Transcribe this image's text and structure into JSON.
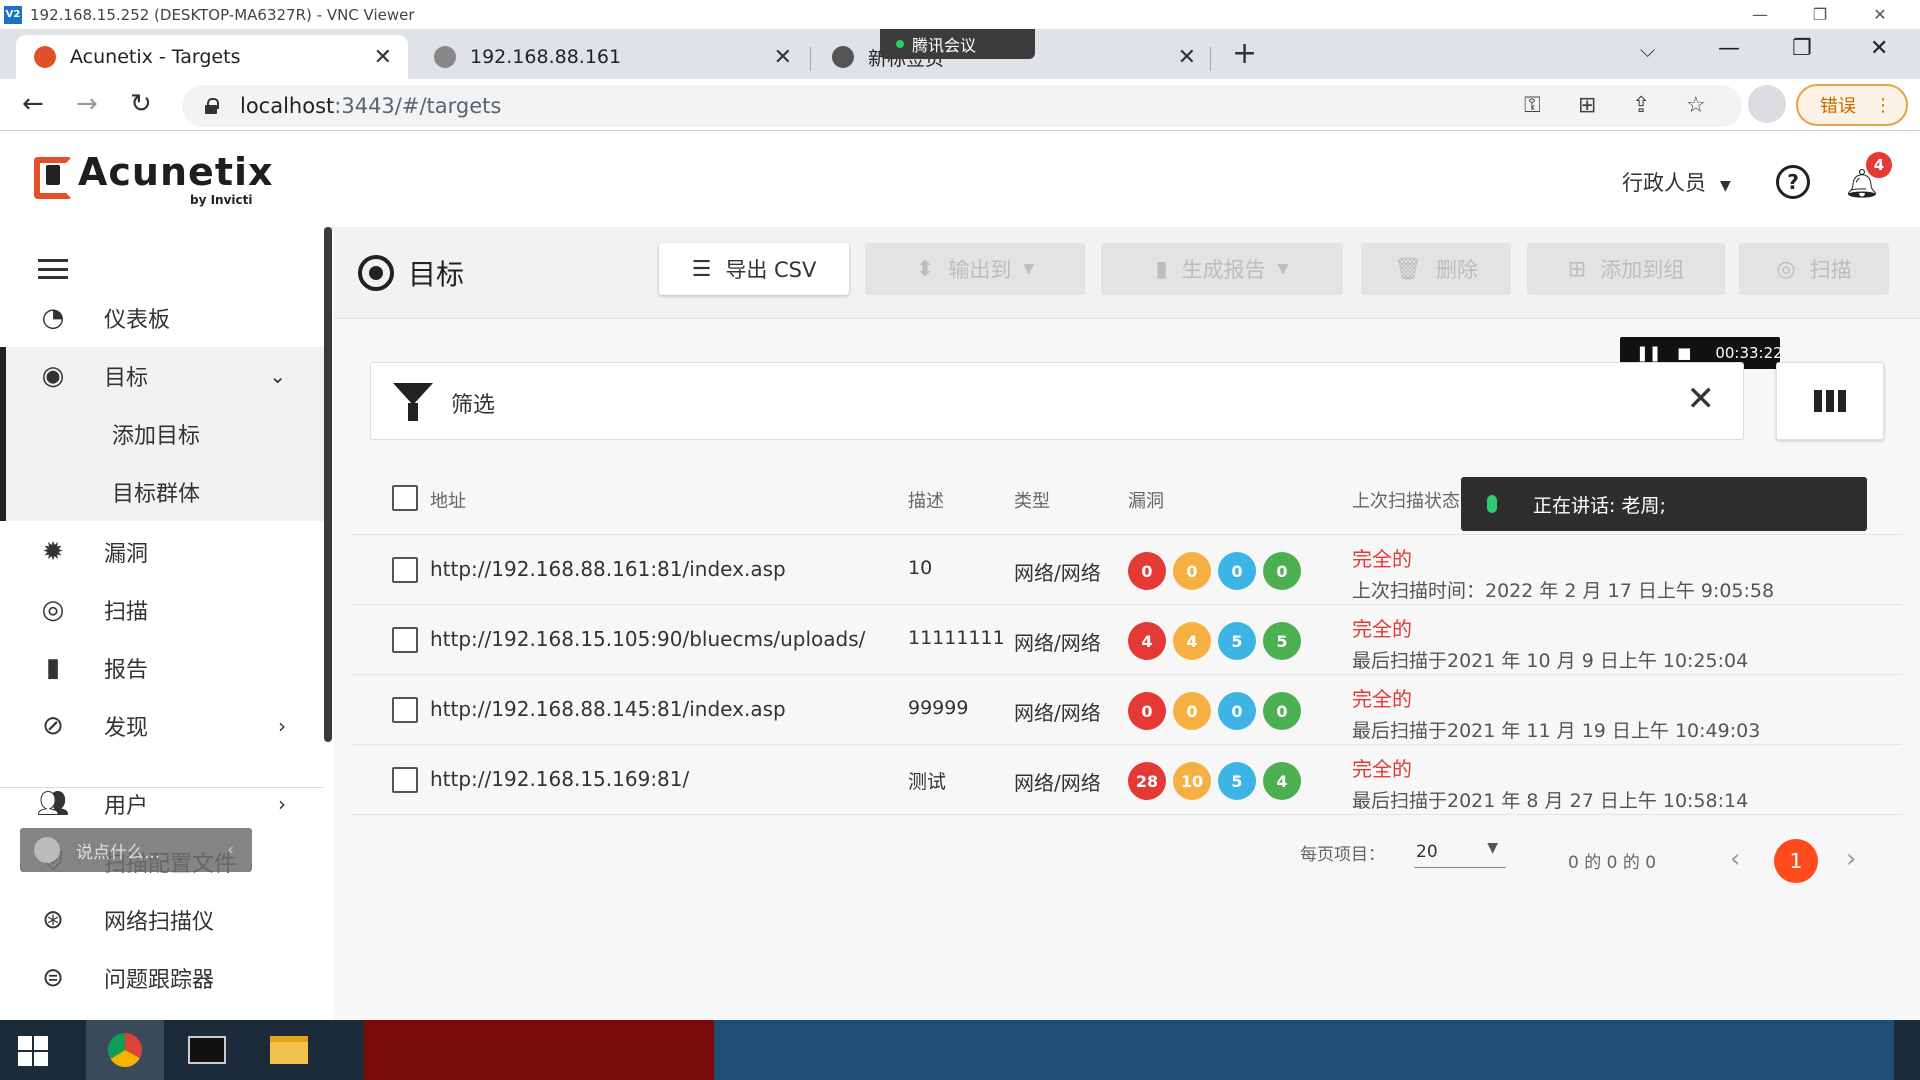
{
  "vnc": {
    "title": "192.168.15.252 (DESKTOP-MA6327R) - VNC Viewer",
    "logo": "V2"
  },
  "browser": {
    "tabs": [
      {
        "title": "Acunetix - Targets",
        "active": true
      },
      {
        "title": "192.168.88.161",
        "active": false
      },
      {
        "title": "新标签页",
        "active": false
      }
    ],
    "meeting_overlay": "腾讯会议",
    "url_host": "localhost",
    "url_rest": ":3443/#/targets",
    "error_button": "错误"
  },
  "app": {
    "logo_text": "Acunetix",
    "logo_sub": "by Invicti",
    "user": "行政人员",
    "notifications": "4"
  },
  "sidebar": {
    "items": [
      {
        "label": "仪表板",
        "icon": "dashboard-icon"
      },
      {
        "label": "目标",
        "icon": "target-icon"
      },
      {
        "label": "添加目标"
      },
      {
        "label": "目标群体"
      },
      {
        "label": "漏洞",
        "icon": "bug-icon"
      },
      {
        "label": "扫描",
        "icon": "scan-icon"
      },
      {
        "label": "报告",
        "icon": "report-icon"
      },
      {
        "label": "发现",
        "icon": "discovery-icon"
      },
      {
        "label": "用户",
        "icon": "users-icon"
      },
      {
        "label": "扫描配置文件",
        "icon": "shield-icon"
      },
      {
        "label": "网络扫描仪",
        "icon": "network-scanner-icon"
      },
      {
        "label": "问题跟踪器",
        "icon": "issue-tracker-icon"
      }
    ],
    "chat_placeholder": "说点什么..."
  },
  "toolbar": {
    "title": "目标",
    "export_csv": "导出 CSV",
    "export_to": "输出到",
    "generate_report": "生成报告",
    "delete": "删除",
    "add_to_group": "添加到组",
    "scan": "扫描"
  },
  "recording": {
    "time": "00:33:22"
  },
  "filter": {
    "label": "筛选"
  },
  "table": {
    "headers": {
      "address": "地址",
      "description": "描述",
      "type": "类型",
      "vulns": "漏洞",
      "last_scan": "上次扫描状态"
    },
    "rows": [
      {
        "address": "http://192.168.88.161:81/index.asp",
        "description": "10",
        "type": "网络/网络",
        "vulns": [
          "0",
          "0",
          "0",
          "0"
        ],
        "status": "完全的",
        "scan_time": "上次扫描时间：2022 年 2 月 17 日上午 9:05:58"
      },
      {
        "address": "http://192.168.15.105:90/bluecms/uploads/",
        "description": "11111111",
        "type": "网络/网络",
        "vulns": [
          "4",
          "4",
          "5",
          "5"
        ],
        "status": "完全的",
        "scan_time": "最后扫描于2021 年 10 月 9 日上午 10:25:04"
      },
      {
        "address": "http://192.168.88.145:81/index.asp",
        "description": "99999",
        "type": "网络/网络",
        "vulns": [
          "0",
          "0",
          "0",
          "0"
        ],
        "status": "完全的",
        "scan_time": "最后扫描于2021 年 11 月 19 日上午 10:49:03"
      },
      {
        "address": "http://192.168.15.169:81/",
        "description": "测试",
        "type": "网络/网络",
        "vulns": [
          "28",
          "10",
          "5",
          "4"
        ],
        "status": "完全的",
        "scan_time": "最后扫描于2021 年 8 月 27 日上午 10:58:14"
      }
    ]
  },
  "speaking": {
    "text": "正在讲话: 老周;"
  },
  "pagination": {
    "per_page_label": "每页项目：",
    "per_page": "20",
    "count": "0 的 0 的 0",
    "current": "1"
  },
  "colors": {
    "high": "#e53935",
    "medium": "#f5b041",
    "low": "#3cb4e6",
    "info": "#4caf50",
    "accent": "#ff4a1c"
  }
}
